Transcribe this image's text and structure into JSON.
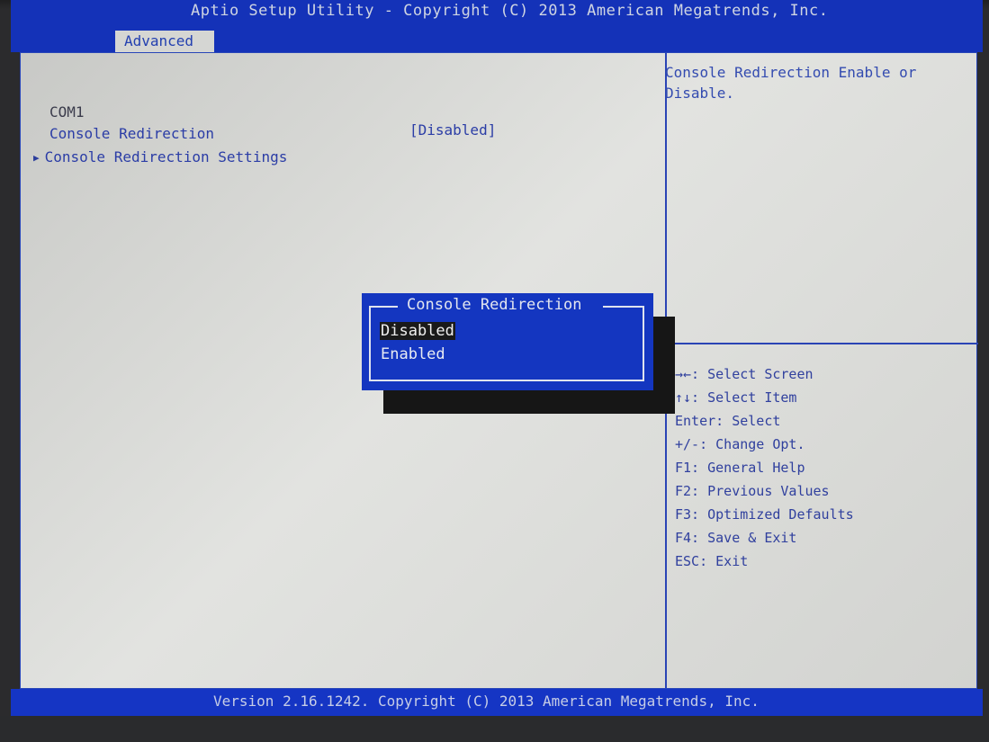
{
  "header": {
    "title": "Aptio Setup Utility - Copyright (C) 2013 American Megatrends, Inc.",
    "active_tab": "Advanced"
  },
  "settings": {
    "section_label": "COM1",
    "items": [
      {
        "label": "Console Redirection",
        "value": "[Disabled]"
      },
      {
        "label": "Console Redirection Settings",
        "submenu": true
      }
    ]
  },
  "help": {
    "description": "Console Redirection Enable or\nDisable."
  },
  "key_help": [
    "→←: Select Screen",
    "↑↓: Select Item",
    "Enter: Select",
    "+/-: Change Opt.",
    "F1: General Help",
    "F2: Previous Values",
    "F3: Optimized Defaults",
    "F4: Save & Exit",
    "ESC: Exit"
  ],
  "popup": {
    "title": "Console Redirection",
    "options": [
      "Disabled",
      "Enabled"
    ],
    "selected": "Disabled"
  },
  "footer": {
    "text": "Version 2.16.1242. Copyright (C) 2013 American Megatrends, Inc."
  },
  "colors": {
    "bios_blue": "#1436c0",
    "panel_grey": "#d5d6d3",
    "text_blue": "#2b3da6"
  }
}
